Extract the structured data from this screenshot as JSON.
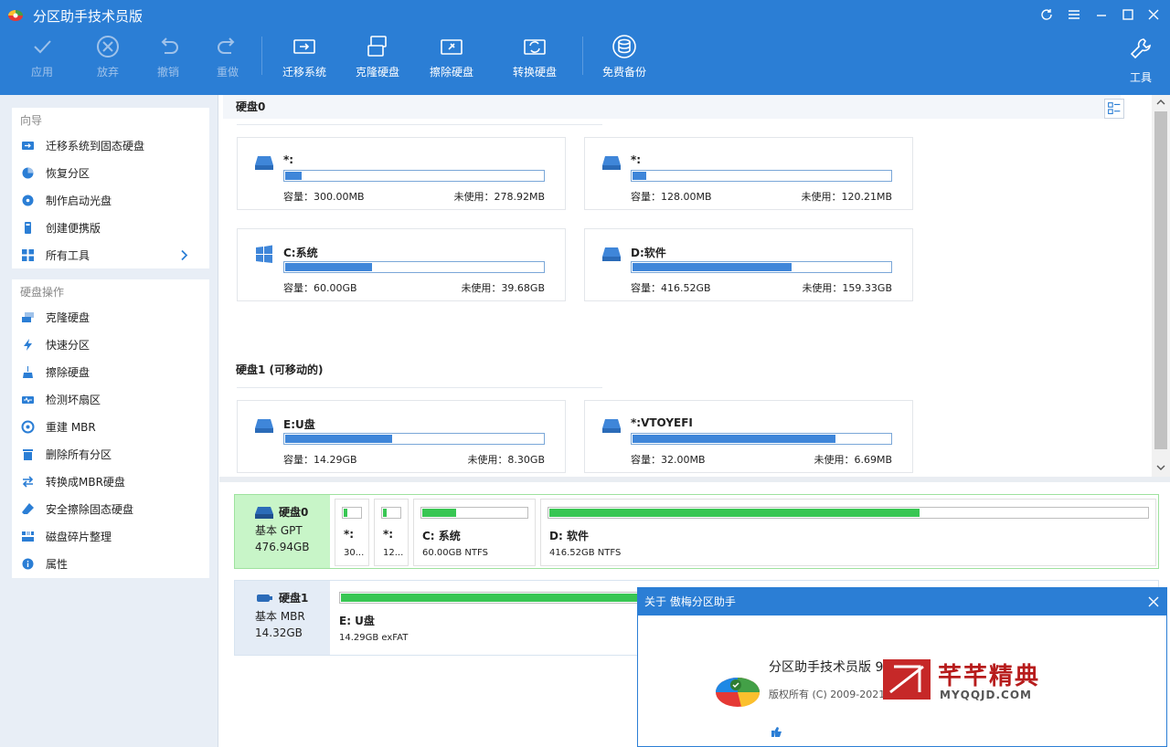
{
  "app": {
    "title": "分区助手技术员版"
  },
  "colors": {
    "accent": "#2b7ed5",
    "bar_blue": "#3f86d9",
    "bar_green": "#38c653",
    "watermark": "#b71c1c"
  },
  "toolbar": {
    "apply": "应用",
    "discard": "放弃",
    "undo": "撤销",
    "redo": "重做",
    "migrate": "迁移系统",
    "clone": "克隆硬盘",
    "wipe": "擦除硬盘",
    "convert": "转换硬盘",
    "backup": "免费备份",
    "tools": "工具"
  },
  "sidebar": {
    "wizard_header": "向导",
    "wizard_items": [
      {
        "label": "迁移系统到固态硬盘",
        "icon": "migrate-icon"
      },
      {
        "label": "恢复分区",
        "icon": "recover-icon"
      },
      {
        "label": "制作启动光盘",
        "icon": "bootable-disc-icon"
      },
      {
        "label": "创建便携版",
        "icon": "portable-icon"
      },
      {
        "label": "所有工具",
        "icon": "all-tools-icon"
      }
    ],
    "disk_header": "硬盘操作",
    "disk_items": [
      {
        "label": "克隆硬盘",
        "icon": "clone-icon"
      },
      {
        "label": "快速分区",
        "icon": "lightning-icon"
      },
      {
        "label": "擦除硬盘",
        "icon": "wipe-icon"
      },
      {
        "label": "检测坏扇区",
        "icon": "bad-sector-icon"
      },
      {
        "label": "重建 MBR",
        "icon": "mbr-icon"
      },
      {
        "label": "删除所有分区",
        "icon": "delete-icon"
      },
      {
        "label": "转换成MBR硬盘",
        "icon": "convert-icon"
      },
      {
        "label": "安全擦除固态硬盘",
        "icon": "eraser-icon"
      },
      {
        "label": "磁盘碎片整理",
        "icon": "defrag-icon"
      },
      {
        "label": "属性",
        "icon": "info-icon"
      }
    ]
  },
  "disks": [
    {
      "header": "硬盘0",
      "cards": [
        {
          "name": "*:",
          "capacity": "容量：300.00MB",
          "free": "未使用：278.92MB",
          "used": 0.07,
          "icon": "drive-icon"
        },
        {
          "name": "*:",
          "capacity": "容量：128.00MB",
          "free": "未使用：120.21MB",
          "used": 0.06,
          "icon": "drive-icon"
        },
        {
          "name": "C:系统",
          "capacity": "容量：60.00GB",
          "free": "未使用：39.68GB",
          "used": 0.34,
          "icon": "windows-icon"
        },
        {
          "name": "D:软件",
          "capacity": "容量：416.52GB",
          "free": "未使用：159.33GB",
          "used": 0.62,
          "icon": "drive-icon"
        }
      ]
    },
    {
      "header": "硬盘1 (可移动的)",
      "cards": [
        {
          "name": "E:U盘",
          "capacity": "容量：14.29GB",
          "free": "未使用：8.30GB",
          "used": 0.42,
          "icon": "drive-icon"
        },
        {
          "name": "*:VTOYEFI",
          "capacity": "容量：32.00MB",
          "free": "未使用：6.69MB",
          "used": 0.79,
          "icon": "drive-icon"
        }
      ]
    }
  ],
  "disk_map": [
    {
      "name": "硬盘0",
      "type": "基本 GPT",
      "size": "476.94GB",
      "parts": [
        {
          "name": "*:",
          "info": "30...",
          "used": 0.3
        },
        {
          "name": "*:",
          "info": "12...",
          "used": 0.3
        },
        {
          "name": "C: 系统",
          "info": "60.00GB NTFS",
          "used": 0.34
        },
        {
          "name": "D: 软件",
          "info": "416.52GB NTFS",
          "used": 0.62
        }
      ]
    },
    {
      "name": "硬盘1",
      "type": "基本 MBR",
      "size": "14.32GB",
      "parts": [
        {
          "name": "E: U盘",
          "info": "14.29GB exFAT",
          "used": 0.42
        }
      ]
    }
  ],
  "dialog": {
    "title": "关于 傲梅分区助手",
    "product": "分区助手技术员版 9.4",
    "copyright": "版权所有 (C) 2009-2021 成都"
  },
  "watermark": {
    "title": "芊芊精典",
    "site": "MYQQJD.COM"
  }
}
